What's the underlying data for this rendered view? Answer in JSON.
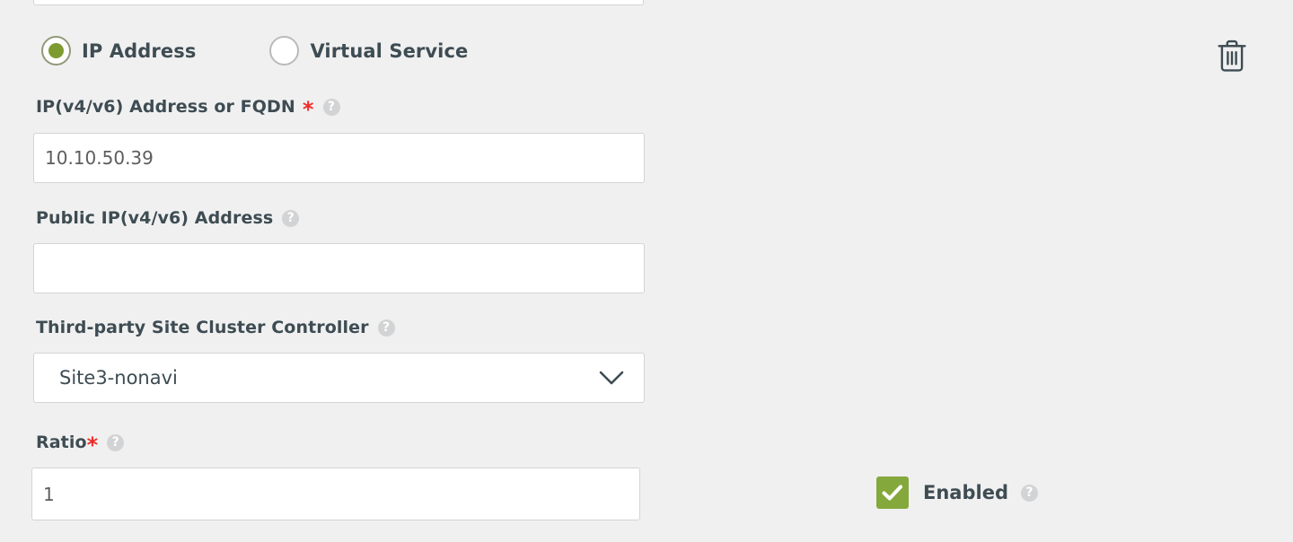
{
  "colors": {
    "page_background": "#f0f0f0",
    "text": "#3e4c53",
    "required_star": "#ee2c27",
    "radio_selected_fill": "#7d9b2f",
    "radio_selected_ring": "#919a7a",
    "checkbox_enabled": "#85a83d",
    "help_icon": "#d2d3d4",
    "input_border": "#d3d4d5",
    "icon_dark": "#3e4c53"
  },
  "top_partial_field": {
    "overflow_marker": "····"
  },
  "server_type": {
    "options": [
      {
        "label": "IP Address",
        "selected": true,
        "icon": "radio-selected-icon"
      },
      {
        "label": "Virtual Service",
        "selected": false,
        "icon": "radio-unselected-icon"
      }
    ]
  },
  "delete_action": {
    "icon": "trash-icon",
    "tooltip": "Delete"
  },
  "fields": {
    "ip_address": {
      "label": "IP(v4/v6) Address or FQDN",
      "required": true,
      "required_marker": "*",
      "help_icon": "help-icon",
      "help_glyph": "?",
      "value": "10.10.50.39",
      "placeholder": ""
    },
    "public_ip": {
      "label": "Public IP(v4/v6) Address",
      "required": false,
      "help_icon": "help-icon",
      "help_glyph": "?",
      "value": "",
      "placeholder": ""
    },
    "site_cluster_controller": {
      "label": "Third-party Site Cluster Controller",
      "required": false,
      "help_icon": "help-icon",
      "help_glyph": "?",
      "selected_option": "Site3-nonavi",
      "chevron_icon": "chevron-down-icon"
    },
    "ratio": {
      "label": "Ratio",
      "required": true,
      "required_marker": "*",
      "help_icon": "help-icon",
      "help_glyph": "?",
      "value": "1",
      "placeholder": ""
    }
  },
  "enabled_toggle": {
    "label": "Enabled",
    "checked": true,
    "check_icon": "checkmark-icon",
    "help_icon": "help-icon",
    "help_glyph": "?"
  }
}
